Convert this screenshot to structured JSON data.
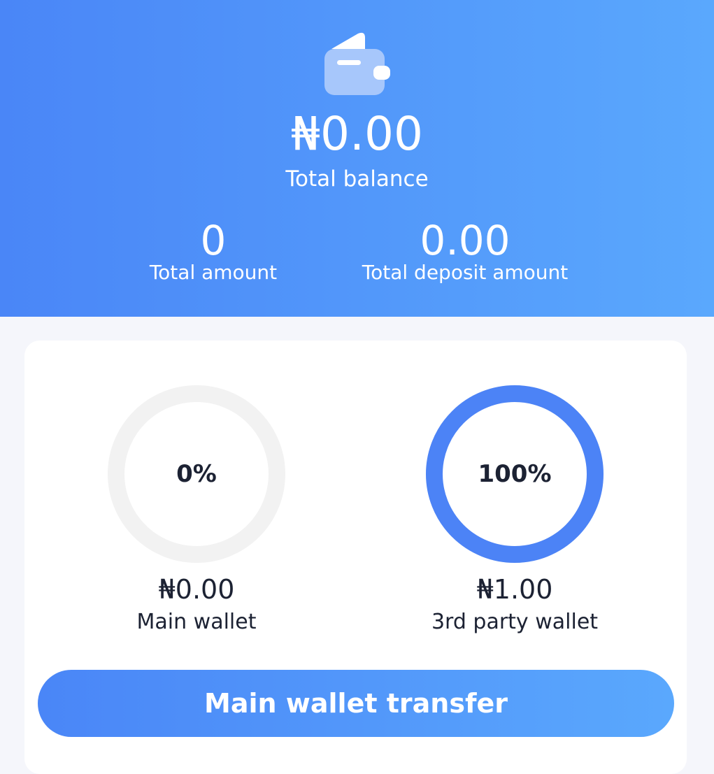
{
  "summary": {
    "total_balance_value": "₦0.00",
    "total_balance_label": "Total balance",
    "total_amount_value": "0",
    "total_amount_label": "Total amount",
    "total_deposit_value": "0.00",
    "total_deposit_label": "Total deposit amount"
  },
  "wallets": [
    {
      "percent_label": "0%",
      "percent": 0,
      "amount": "₦0.00",
      "label": "Main wallet",
      "ring_color": "#f2f2f2"
    },
    {
      "percent_label": "100%",
      "percent": 100,
      "amount": "₦1.00",
      "label": "3rd party wallet",
      "ring_color": "#4c83f6"
    }
  ],
  "transfer_button_label": "Main wallet transfer",
  "colors": {
    "header_gradient_start": "#4a86f7",
    "header_gradient_end": "#5aa8fd",
    "ring_track": "#f2f2f2",
    "ring_fill": "#4c83f6",
    "text_dark": "#1c2233"
  },
  "icons": {
    "header_icon": "wallet-icon"
  }
}
